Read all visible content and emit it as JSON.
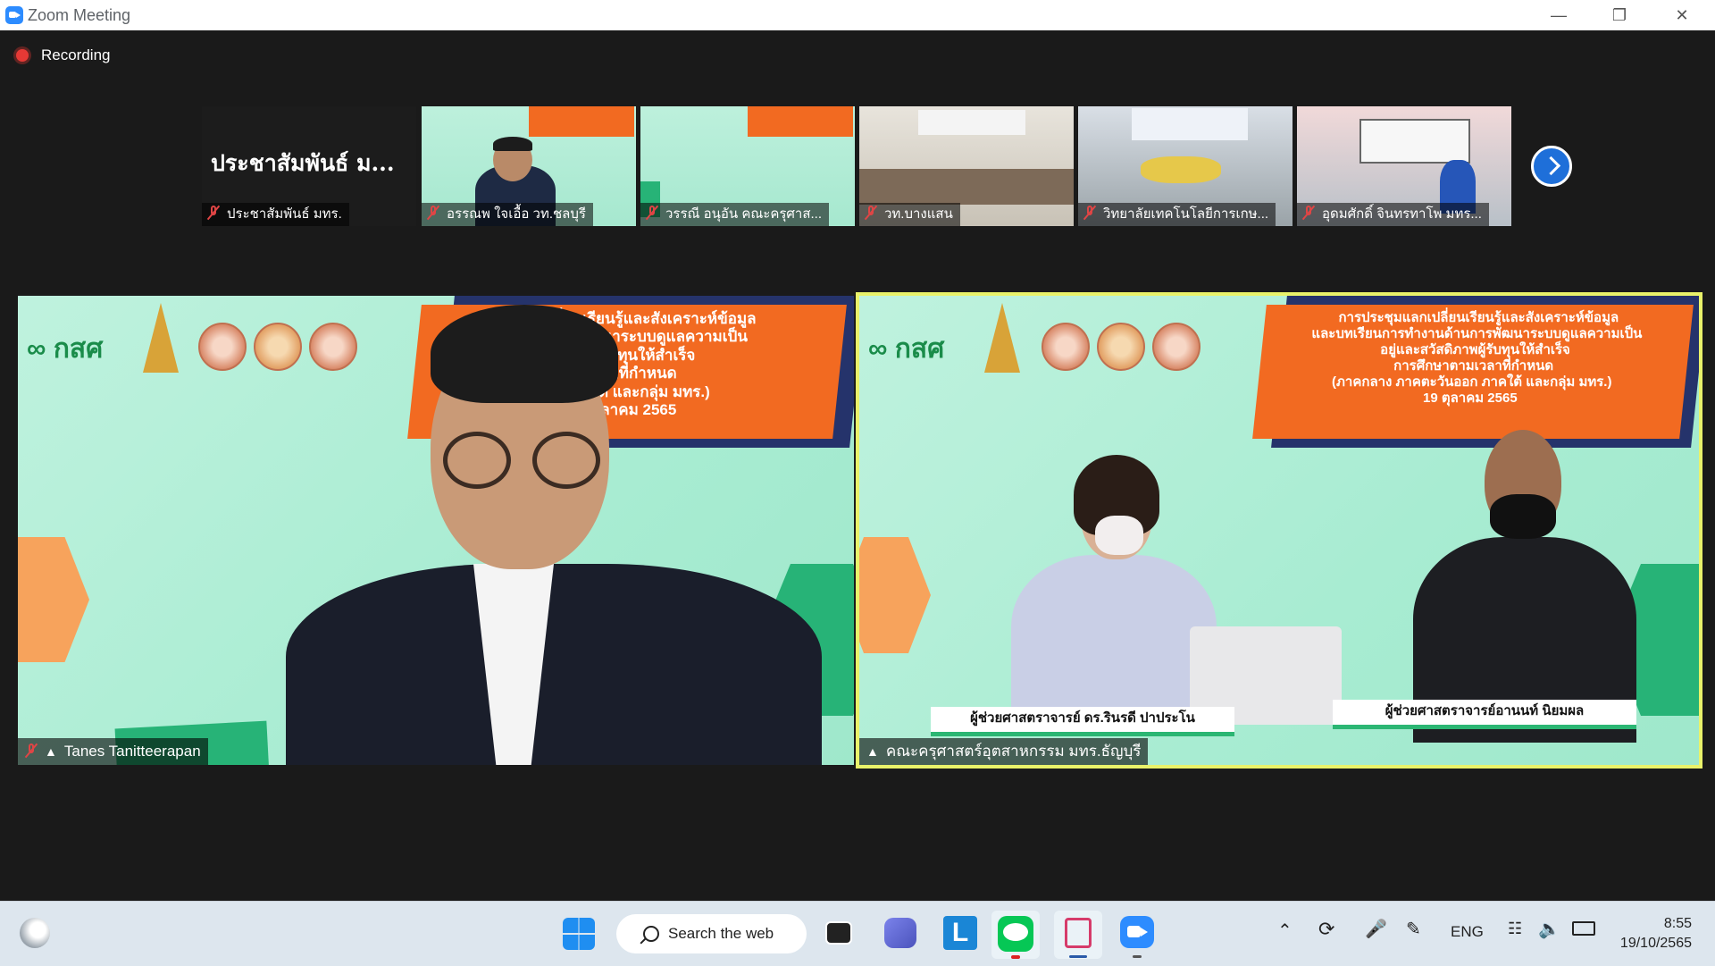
{
  "window": {
    "title": "Zoom Meeting"
  },
  "recording": {
    "label": "Recording"
  },
  "thumbnails": [
    {
      "name": "ประชาสัมพันธ์ มทร.",
      "big_name": "ประชาสัมพันธ์ ม..."
    },
    {
      "name": "อรรณพ  ใจเอื้อ วท.ชลบุรี"
    },
    {
      "name": "วรรณี  อนุอัน คณะครุศาส..."
    },
    {
      "name": "วท.บางแสน"
    },
    {
      "name": "วิทยาลัยเทคโนโลยีการเกษ..."
    },
    {
      "name": "อุดมศักดิ์ จินทรทาโพ มทร..."
    }
  ],
  "main_left": {
    "participant": "Tanes Tanitteerapan",
    "logo_text": "กสศ",
    "banner_lines": [
      "การ      เปลี่ยนเรียนรู้และสังเคราะห์ข้อมูล",
      "เ       ท้านการพัฒนาระบบดูแลความเป็น",
      "ภาพผู้รับทุนให้สำเร็จ",
      "นเวลาที่กำหนด",
      "อก ภาคใต้ และกลุ่ม มทร.)",
      "19 ตุลาคม 2565"
    ]
  },
  "main_right": {
    "participant": "คณะครุศาสตร์อุตสาหกรรม มทร.ธัญบุรี",
    "logo_text": "กสศ",
    "banner_lines": [
      "การประชุมแลกเปลี่ยนเรียนรู้และสังเคราะห์ข้อมูล",
      "และบทเรียนการทำงานด้านการพัฒนาระบบดูแลความเป็น",
      "อยู่และสวัสดิภาพผู้รับทุนให้สำเร็จ",
      "การศึกษาตามเวลาที่กำหนด",
      "(ภาคกลาง ภาคตะวันออก ภาคใต้ และกลุ่ม มทร.)",
      "19 ตุลาคม 2565"
    ],
    "speaker_left": "ผู้ช่วยศาสตราจารย์ ดร.รินรดี ปาประโน",
    "speaker_right": "ผู้ช่วยศาสตราจารย์อานนท์ นิยมผล"
  },
  "taskbar": {
    "search_label": "Search the web",
    "lang": "ENG",
    "time": "8:55",
    "date": "19/10/2565",
    "icons": [
      "weather-icon",
      "windows-start-icon",
      "task-view-icon",
      "teams-chat-icon",
      "l-app-icon",
      "line-app-icon",
      "snipping-tool-icon",
      "zoom-app-icon"
    ]
  }
}
